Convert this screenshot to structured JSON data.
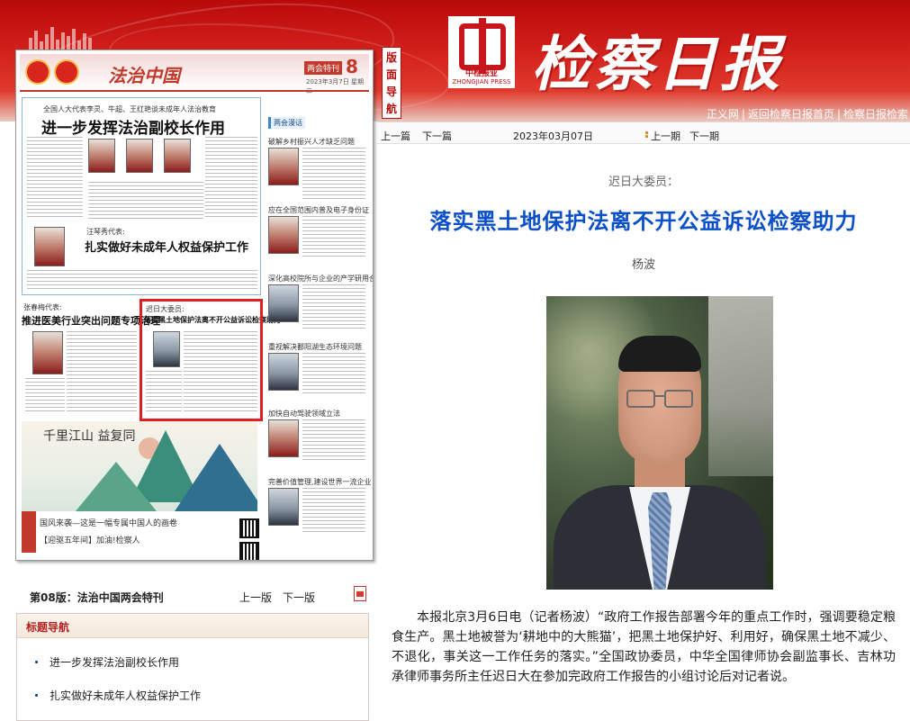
{
  "header": {
    "masthead": "检察日报",
    "logo_cn": "中检报业",
    "logo_en": "ZHONGJIAN PRESS",
    "vertical_nav": "版面导航",
    "links": [
      "正义网",
      "返回检察日报首页",
      "检察日报检索"
    ]
  },
  "thumbnail": {
    "brand": "法治中国",
    "tag": "两会特刊",
    "page_number": "8",
    "date": "2023年3月7日 星期二",
    "articles": [
      {
        "kicker": "全国人大代表李灵、牛超、王红艳谈未成年人法治教育",
        "title": "进一步发挥法治副校长作用"
      },
      {
        "kicker": "汪琴秀代表:",
        "title": "扎实做好未成年人权益保护工作"
      },
      {
        "kicker": "张春梅代表:",
        "title": "推进医美行业突出问题专项治理"
      },
      {
        "kicker": "迟日大委员:",
        "title": "落实黑土地保护法离不开公益诉讼检察助力"
      }
    ],
    "side_column_label": "两会漫话",
    "side_items": [
      "破解乡村振兴人才缺乏问题",
      "应在全国范围内普及电子身份证",
      "深化高校院所与企业的产学研用合作",
      "重视解决鄱阳湖生态环境问题",
      "加快自动驾驶领域立法",
      "完善价值管理,建设世界一流企业"
    ],
    "painting_caption": "千里江山 益复同",
    "footer_line1": "国风来袭—这是一幅专属中国人的画卷",
    "footer_line2": "【迎驱五年间】加油!检察人"
  },
  "page_nav": {
    "page_label": "第08版：法治中国两会特刊",
    "prev": "上一版",
    "next": "下一版"
  },
  "toc": {
    "title": "标题导航",
    "items": [
      "进一步发挥法治副校长作用",
      "扎实做好未成年人权益保护工作"
    ]
  },
  "article_nav": {
    "prev_article": "上一篇",
    "next_article": "下一篇",
    "date": "2023年03月07日",
    "prev_issue": "上一期",
    "next_issue": "下一期"
  },
  "article": {
    "kicker": "迟日大委员：",
    "headline": "落实黑土地保护法离不开公益诉讼检察助力",
    "byline": "杨波",
    "body": "本报北京3月6日电（记者杨波）“政府工作报告部署今年的重点工作时，强调要稳定粮食生产。黑土地被誉为‘耕地中的大熊猫’，把黑土地保护好、利用好，确保黑土地不减少、不退化，事关这一工作任务的落实。”全国政协委员，中华全国律师协会副监事长、吉林功承律师事务所主任迟日大在参加完政府工作报告的小组讨论后对记者说。"
  }
}
